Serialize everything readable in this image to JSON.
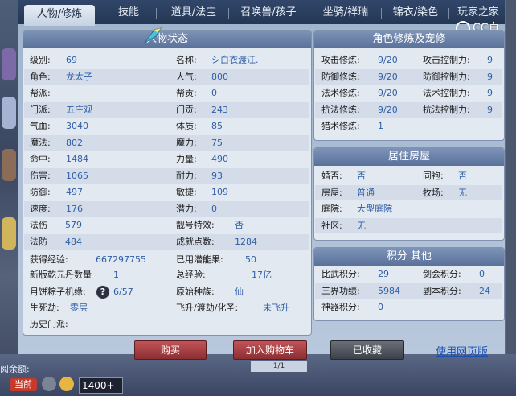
{
  "tabs": [
    "人物/修炼",
    "技能",
    "道具/法宝",
    "召唤兽/孩子",
    "坐骑/祥瑞",
    "锦衣/染色",
    "玩家之家"
  ],
  "watermark": "CC直播",
  "status": {
    "title": "人物状态",
    "left_col": [
      {
        "label": "级别:",
        "value": "69"
      },
      {
        "label": "角色:",
        "value": "龙太子"
      },
      {
        "label": "帮派:",
        "value": ""
      },
      {
        "label": "门派:",
        "value": "五庄观"
      },
      {
        "label": "气血:",
        "value": "3040"
      },
      {
        "label": "魔法:",
        "value": "802"
      },
      {
        "label": "命中:",
        "value": "1484"
      },
      {
        "label": "伤害:",
        "value": "1065"
      },
      {
        "label": "防御:",
        "value": "497"
      },
      {
        "label": "速度:",
        "value": "176"
      },
      {
        "label": "法伤",
        "value": "579"
      },
      {
        "label": "法防",
        "value": "484"
      }
    ],
    "right_col": [
      {
        "label": "名称:",
        "value": "シ白衣渡江."
      },
      {
        "label": "人气:",
        "value": "800"
      },
      {
        "label": "帮贡:",
        "value": "0"
      },
      {
        "label": "门贡:",
        "value": "243"
      },
      {
        "label": "体质:",
        "value": "85"
      },
      {
        "label": "魔力:",
        "value": "75"
      },
      {
        "label": "力量:",
        "value": "490"
      },
      {
        "label": "耐力:",
        "value": "93"
      },
      {
        "label": "敏捷:",
        "value": "109"
      },
      {
        "label": "潜力:",
        "value": "0"
      },
      {
        "label": "靓号特效:",
        "value": "否"
      },
      {
        "label": "成就点数:",
        "value": "1284"
      }
    ],
    "exp_label": "获得经验:",
    "exp_value": "667297755",
    "used_pot_label": "已用潜能果:",
    "used_pot_value": "50",
    "dan_label": "新版乾元丹数量",
    "dan_value": "1",
    "total_exp_label": "总经验:",
    "total_exp_value": "17亿",
    "zongzi_label": "月饼粽子机缘:",
    "zongzi_value": "6/57",
    "race_label": "原始种族:",
    "race_value": "仙",
    "life_label": "生死劫:",
    "life_value": "零层",
    "ascend_label": "飞升/渡劫/化圣:",
    "ascend_value": "未飞升",
    "history_label": "历史门派:"
  },
  "cultivation": {
    "title": "角色修炼及宠修",
    "rows": [
      {
        "l1": "攻击修炼:",
        "v1": "9/20",
        "l2": "攻击控制力:",
        "v2": "9"
      },
      {
        "l1": "防御修炼:",
        "v1": "9/20",
        "l2": "防御控制力:",
        "v2": "9"
      },
      {
        "l1": "法术修炼:",
        "v1": "9/20",
        "l2": "法术控制力:",
        "v2": "9"
      },
      {
        "l1": "抗法修炼:",
        "v1": "9/20",
        "l2": "抗法控制力:",
        "v2": "9"
      },
      {
        "l1": "猎术修炼:",
        "v1": "1",
        "l2": "",
        "v2": ""
      }
    ]
  },
  "house": {
    "title": "居住房屋",
    "rows": [
      {
        "l1": "婚否:",
        "v1": "否",
        "l2": "同袍:",
        "v2": "否"
      },
      {
        "l1": "房屋:",
        "v1": "普通",
        "l2": "牧场:",
        "v2": "无"
      },
      {
        "l1": "庭院:",
        "v1": "大型庭院",
        "l2": "",
        "v2": ""
      },
      {
        "l1": "社区:",
        "v1": "无",
        "l2": "",
        "v2": ""
      }
    ]
  },
  "points": {
    "title": "积分 其他",
    "rows": [
      {
        "l1": "比武积分:",
        "v1": "29",
        "l2": "剑会积分:",
        "v2": "0"
      },
      {
        "l1": "三界功绩:",
        "v1": "5984",
        "l2": "副本积分:",
        "v2": "24"
      },
      {
        "l1": "神器积分:",
        "v1": "0",
        "l2": "",
        "v2": ""
      }
    ]
  },
  "buttons": {
    "buy": "购买",
    "cart": "加入购物车",
    "fav": "已收藏",
    "web": "使用网页版"
  },
  "bottom": {
    "current": "当前",
    "input": "1400+",
    "page": "1/1",
    "side_text": "阅余额:"
  }
}
